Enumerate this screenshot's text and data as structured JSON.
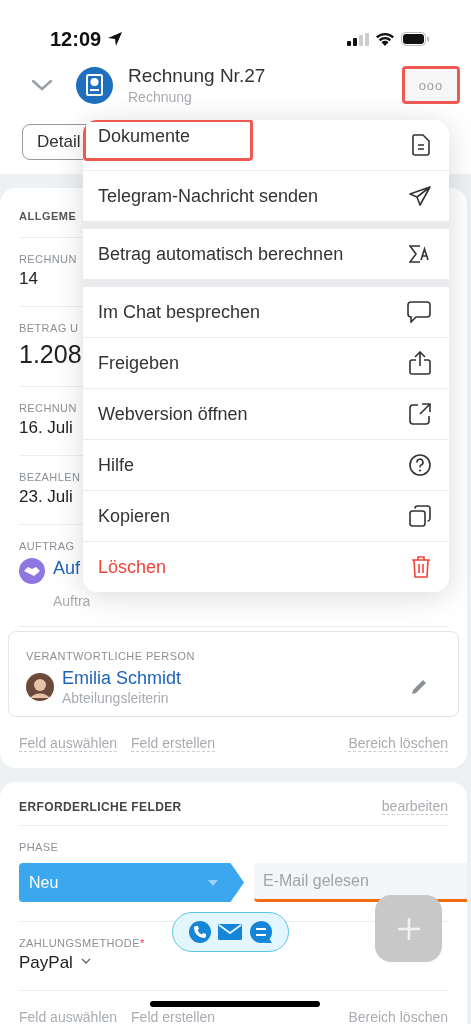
{
  "status_bar": {
    "time": "12:09"
  },
  "header": {
    "title": "Rechnung Nr.27",
    "subtitle": "Rechnung",
    "more_button": {
      "label": "ooo",
      "highlighted": true
    }
  },
  "tabs": [
    {
      "label": "Detail",
      "selected": false
    }
  ],
  "general": {
    "title": "ALLGEME",
    "fields": [
      {
        "kind": "text",
        "label": "RECHNUN",
        "value": "14"
      },
      {
        "kind": "amount",
        "label": "BETRAG U",
        "value": "1.208"
      },
      {
        "kind": "text",
        "label": "RECHNUN",
        "value": "16. Juli"
      },
      {
        "kind": "text",
        "label": "BEZAHLEN",
        "value": "23. Juli"
      },
      {
        "kind": "link",
        "label": "AUFTRAG",
        "value": "Auf",
        "sub": "Auftra"
      }
    ],
    "person": {
      "label": "VERANTWORTLICHE PERSON",
      "name": "Emilia Schmidt",
      "role": "Abteilungsleiterin"
    },
    "links": [
      "Feld auswählen",
      "Feld erstellen",
      "Bereich löschen"
    ]
  },
  "required": {
    "title": "ERFORDERLICHE FELDER",
    "edit": "bearbeiten",
    "phase": {
      "label": "PHASE",
      "current": "Neu",
      "next": "E-Mail gelesen"
    },
    "payment": {
      "label": "ZAHLUNGSMETHODE",
      "required_mark": "*",
      "value": "PayPal"
    },
    "links": [
      "Feld auswählen",
      "Feld erstellen",
      "Bereich löschen"
    ]
  },
  "menu": {
    "groups": [
      [
        {
          "label": "Dokumente",
          "highlighted": true,
          "danger": false
        },
        {
          "label": "Telegram-Nachricht senden",
          "highlighted": false,
          "danger": false
        }
      ],
      [
        {
          "label": "Betrag automatisch berechnen",
          "highlighted": false,
          "danger": false
        }
      ],
      [
        {
          "label": "Im Chat besprechen",
          "highlighted": false,
          "danger": false
        },
        {
          "label": "Freigeben",
          "highlighted": false,
          "danger": false
        },
        {
          "label": "Webversion öffnen",
          "highlighted": false,
          "danger": false
        },
        {
          "label": "Hilfe",
          "highlighted": false,
          "danger": false
        },
        {
          "label": "Kopieren",
          "highlighted": false,
          "danger": false
        },
        {
          "label": "Löschen",
          "highlighted": false,
          "danger": true
        }
      ]
    ]
  }
}
